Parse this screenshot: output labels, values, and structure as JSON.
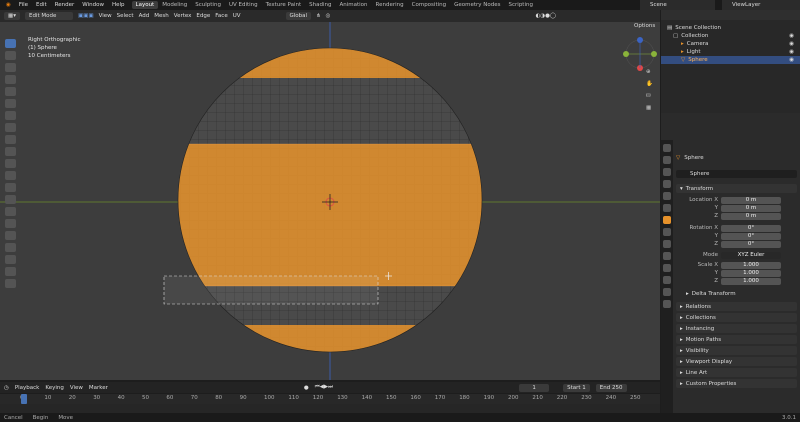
{
  "menu": [
    "File",
    "Edit",
    "Render",
    "Window",
    "Help"
  ],
  "workspaces": [
    "Layout",
    "Modeling",
    "Sculpting",
    "UV Editing",
    "Texture Paint",
    "Shading",
    "Animation",
    "Rendering",
    "Compositing",
    "Geometry Nodes",
    "Scripting"
  ],
  "scene_name": "Scene",
  "view_layer": "ViewLayer",
  "viewport_header": {
    "mode": "Edit Mode",
    "menus": [
      "View",
      "Select",
      "Add",
      "Mesh",
      "Vertex",
      "Edge",
      "Face",
      "UV"
    ],
    "orientation": "Global",
    "options": "Options"
  },
  "viewport_info": {
    "view": "Right Orthographic",
    "object": "(1) Sphere",
    "scale": "10 Centimeters"
  },
  "outliner": {
    "root": "Scene Collection",
    "collection": "Collection",
    "items": [
      "Camera",
      "Light",
      "Sphere"
    ]
  },
  "properties": {
    "object_name": "Sphere",
    "data_name": "Sphere",
    "transform": "Transform",
    "location_label": "Location X",
    "location": [
      "0 m",
      "0 m",
      "0 m"
    ],
    "rotation_label": "Rotation X",
    "rotation": [
      "0°",
      "0°",
      "0°"
    ],
    "mode_label": "Mode",
    "mode": "XYZ Euler",
    "scale_label": "Scale X",
    "scale": [
      "1.000",
      "1.000",
      "1.000"
    ],
    "axis_y": "Y",
    "axis_z": "Z",
    "delta": "Delta Transform",
    "sections": [
      "Relations",
      "Collections",
      "Instancing",
      "Motion Paths",
      "Visibility",
      "Viewport Display",
      "Line Art",
      "Custom Properties"
    ]
  },
  "timeline": {
    "menus": [
      "Playback",
      "Keying",
      "View",
      "Marker"
    ],
    "current_frame": "1",
    "start_label": "Start",
    "start": "1",
    "end_label": "End",
    "end": "250",
    "ticks": [
      "0",
      "10",
      "20",
      "30",
      "40",
      "50",
      "60",
      "70",
      "80",
      "90",
      "100",
      "110",
      "120",
      "130",
      "140",
      "150",
      "160",
      "170",
      "180",
      "190",
      "200",
      "210",
      "220",
      "230",
      "240",
      "250"
    ]
  },
  "status": {
    "items": [
      "Cancel",
      "Begin",
      "Move"
    ],
    "version": "3.0.1"
  },
  "colors": {
    "accent": "#4772b3",
    "selection": "#e8932b",
    "mesh": "#4a4a4a",
    "x_axis": "#8ab33a",
    "z_axis": "#3b64c4"
  }
}
